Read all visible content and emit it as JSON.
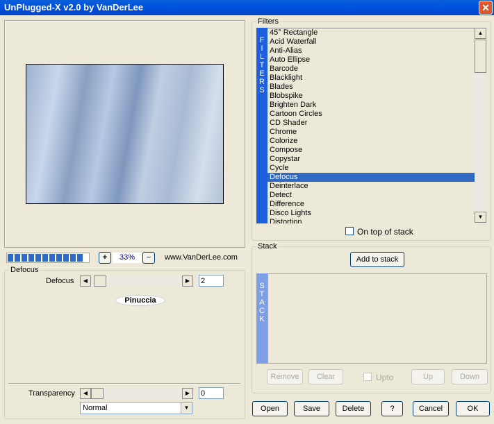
{
  "window": {
    "title": "UnPlugged-X v2.0 by VanDerLee",
    "close_icon": "close-icon"
  },
  "preview": {
    "progress_percent": 100,
    "zoom_in": "+",
    "zoom_value": "33%",
    "zoom_out": "−",
    "website": "www.VanDerLee.com"
  },
  "filter_settings": {
    "group_label": "Defocus",
    "param_label": "Defocus",
    "param_value": "2",
    "logo_text": "Pinuccia"
  },
  "transparency": {
    "label": "Transparency",
    "value": "0",
    "blend_mode": "Normal"
  },
  "filters": {
    "group_label": "Filters",
    "tab_letters": [
      "F",
      "I",
      "L",
      "T",
      "E",
      "R",
      "S"
    ],
    "items": [
      "45° Rectangle",
      "Acid Waterfall",
      "Anti-Alias",
      "Auto Ellipse",
      "Barcode",
      "Blacklight",
      "Blades",
      "Blobspike",
      "Brighten Dark",
      "Cartoon Circles",
      "CD Shader",
      "Chrome",
      "Colorize",
      "Compose",
      "Copystar",
      "Cycle",
      "Defocus",
      "Deinterlace",
      "Detect",
      "Difference",
      "Disco Lights",
      "Distortion"
    ],
    "selected": "Defocus",
    "on_top_label": "On top of stack",
    "on_top_checked": false
  },
  "stack": {
    "group_label": "Stack",
    "add_label": "Add to stack",
    "tab_letters": [
      "S",
      "T",
      "A",
      "C",
      "K"
    ],
    "remove": "Remove",
    "clear": "Clear",
    "upto": "Upto",
    "up": "Up",
    "down": "Down"
  },
  "buttons": {
    "open": "Open",
    "save": "Save",
    "delete": "Delete",
    "help": "?",
    "cancel": "Cancel",
    "ok": "OK"
  },
  "colors": {
    "accent": "#316ac5",
    "tab": "#1e5fdd",
    "progress": "#316ac5"
  }
}
